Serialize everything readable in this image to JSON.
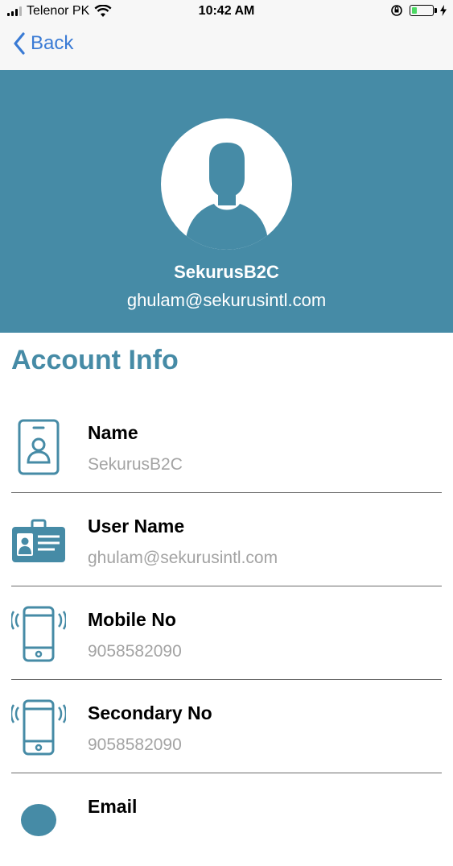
{
  "status_bar": {
    "carrier": "Telenor PK",
    "time": "10:42 AM",
    "battery_level_fraction": 0.25
  },
  "nav": {
    "back_label": "Back",
    "back_icon": "chevron-left-icon"
  },
  "profile": {
    "name": "SekurusB2C",
    "email": "ghulam@sekurusintl.com",
    "avatar_icon": "user-silhouette-icon"
  },
  "section_title": "Account Info",
  "account_info": {
    "items": [
      {
        "label": "Name",
        "value": "SekurusB2C",
        "icon": "id-badge-icon"
      },
      {
        "label": "User Name",
        "value": "ghulam@sekurusintl.com",
        "icon": "id-card-icon"
      },
      {
        "label": "Mobile No",
        "value": "9058582090",
        "icon": "phone-vibrate-icon"
      },
      {
        "label": "Secondary No",
        "value": "9058582090",
        "icon": "phone-vibrate-icon"
      },
      {
        "label": "Email",
        "value": "",
        "icon": "email-icon"
      }
    ]
  },
  "colors": {
    "header_bg": "#468ba6",
    "accent": "#468ba6",
    "back_link": "#3a7bd5",
    "value_text": "#a3a3a3"
  }
}
